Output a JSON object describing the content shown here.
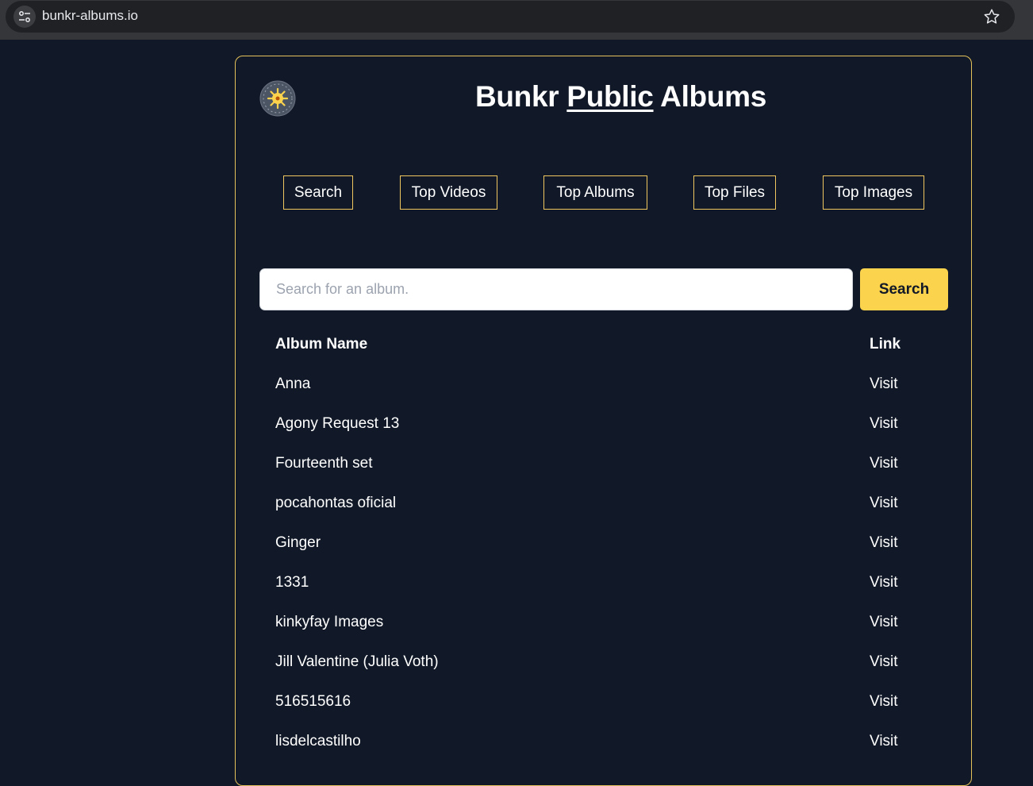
{
  "browser": {
    "url": "bunkr-albums.io"
  },
  "header": {
    "title_part1": "Bunkr",
    "title_part2": "Public",
    "title_part3": "Albums"
  },
  "nav": {
    "items": [
      {
        "label": "Search"
      },
      {
        "label": "Top Videos"
      },
      {
        "label": "Top Albums"
      },
      {
        "label": "Top Files"
      },
      {
        "label": "Top Images"
      }
    ]
  },
  "search": {
    "placeholder": "Search for an album.",
    "value": "",
    "button_label": "Search"
  },
  "table": {
    "columns": [
      "Album Name",
      "Link"
    ],
    "rows": [
      {
        "name": "Anna",
        "link": "Visit"
      },
      {
        "name": "Agony Request 13",
        "link": "Visit"
      },
      {
        "name": "Fourteenth set",
        "link": "Visit"
      },
      {
        "name": "pocahontas oficial",
        "link": "Visit"
      },
      {
        "name": "Ginger",
        "link": "Visit"
      },
      {
        "name": "1331",
        "link": "Visit"
      },
      {
        "name": "kinkyfay Images",
        "link": "Visit"
      },
      {
        "name": "Jill Valentine (Julia Voth)",
        "link": "Visit"
      },
      {
        "name": "516515616",
        "link": "Visit"
      },
      {
        "name": "lisdelcastilho",
        "link": "Visit"
      }
    ]
  },
  "colors": {
    "background": "#111827",
    "accent": "#fcd34d",
    "border": "#f0c75e"
  }
}
